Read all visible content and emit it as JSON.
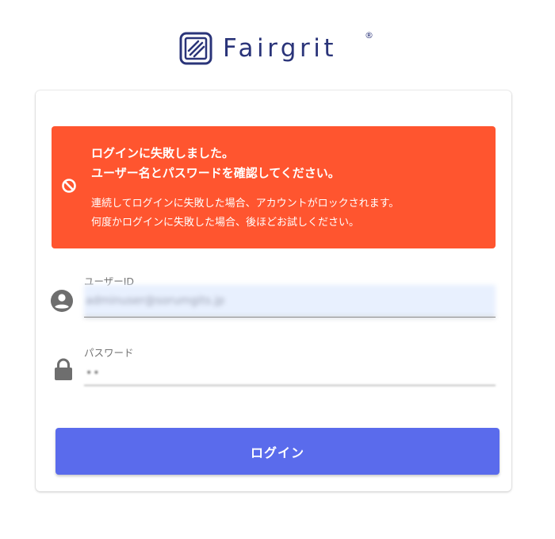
{
  "brand": {
    "name": "Fairgrit",
    "registered_mark": "®",
    "color": "#2a3479"
  },
  "alert": {
    "type": "error",
    "icon": "block-icon",
    "color": "#ff552f",
    "title_line1": "ログインに失敗しました。",
    "title_line2": "ユーザー名とパスワードを確認してください。",
    "detail_line1": "連続してログインに失敗した場合、アカウントがロックされます。",
    "detail_line2": "何度かログインに失敗した場合、後ほどお試しください。"
  },
  "form": {
    "username": {
      "icon": "account-circle-icon",
      "label": "ユーザーID",
      "value": "adminuser@sorumgits.jp"
    },
    "password": {
      "icon": "lock-icon",
      "label": "パスワード",
      "value": "••"
    },
    "submit": {
      "label": "ログイン",
      "color": "#5a6bec"
    }
  }
}
